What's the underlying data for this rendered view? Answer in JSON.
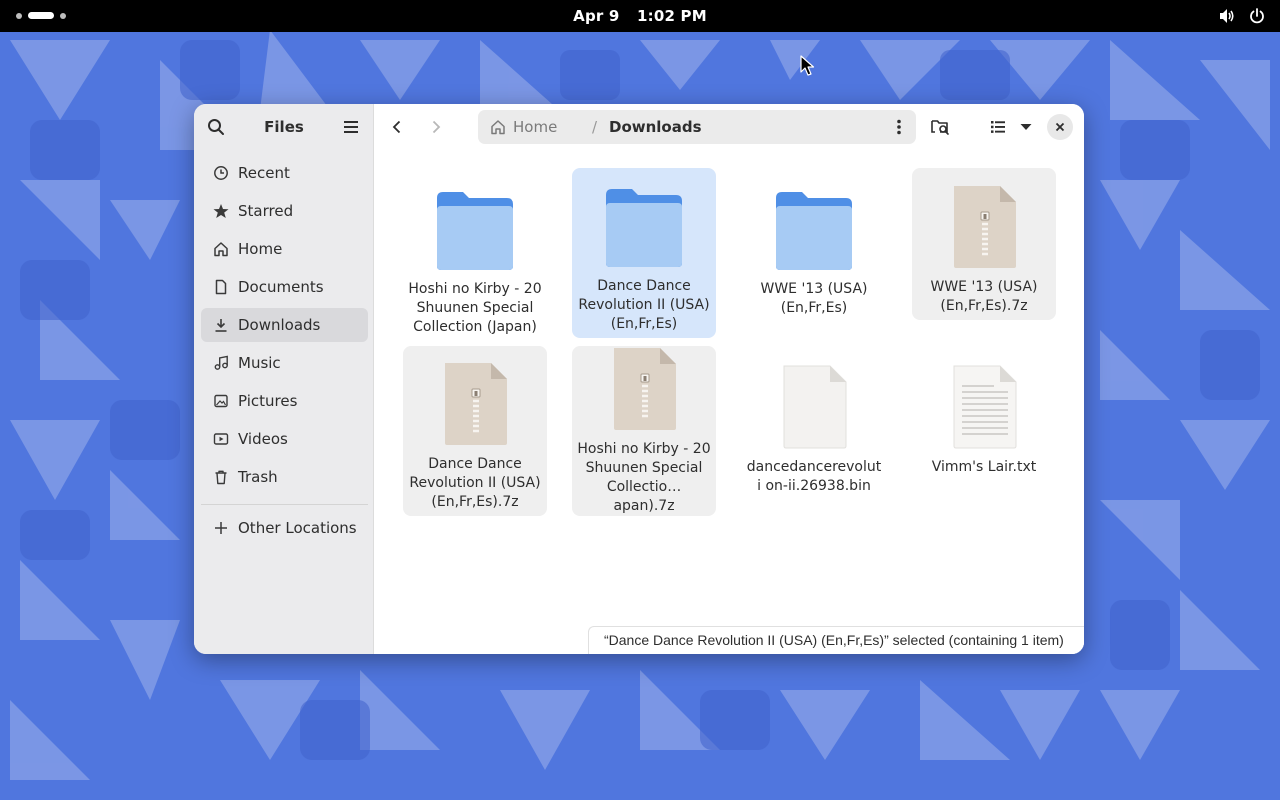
{
  "topbar": {
    "date": "Apr 9",
    "time": "1:02 PM",
    "icons": [
      "volume-icon",
      "power-icon"
    ]
  },
  "sidebar": {
    "title": "Files",
    "items": [
      {
        "label": "Recent",
        "icon": "clock-icon"
      },
      {
        "label": "Starred",
        "icon": "star-icon"
      },
      {
        "label": "Home",
        "icon": "home-icon"
      },
      {
        "label": "Documents",
        "icon": "document-icon"
      },
      {
        "label": "Downloads",
        "icon": "download-icon",
        "active": true
      },
      {
        "label": "Music",
        "icon": "music-icon"
      },
      {
        "label": "Pictures",
        "icon": "picture-icon"
      },
      {
        "label": "Videos",
        "icon": "video-icon"
      },
      {
        "label": "Trash",
        "icon": "trash-icon"
      },
      {
        "label": "Other Locations",
        "icon": "plus-icon"
      }
    ]
  },
  "pathbar": {
    "home": "Home",
    "separator": "/",
    "current": "Downloads"
  },
  "files": [
    {
      "name": "Hoshi no Kirby - 20 Shuunen Special Collection (Japan)",
      "type": "folder"
    },
    {
      "name": "Dance Dance Revolution II (USA) (En,Fr,Es)",
      "type": "folder",
      "selected": true
    },
    {
      "name": "WWE '13 (USA) (En,Fr,Es)",
      "type": "folder"
    },
    {
      "name": "WWE '13 (USA) (En,Fr,Es).7z",
      "type": "archive"
    },
    {
      "name": "Dance Dance Revolution II (USA) (En,Fr,Es).7z",
      "type": "archive"
    },
    {
      "name": "Hoshi no Kirby - 20 Shuunen Special Collectio… apan).7z",
      "type": "archive"
    },
    {
      "name": "dancedancerevoluti on-ii.26938.bin",
      "type": "binary"
    },
    {
      "name": "Vimm's Lair.txt",
      "type": "text"
    }
  ],
  "status": "“Dance Dance Revolution II (USA) (En,Fr,Es)” selected  (containing 1 item)",
  "colors": {
    "accent": "#3584e4",
    "folder": "#a4c9f5",
    "selection": "#d6e6fb"
  }
}
